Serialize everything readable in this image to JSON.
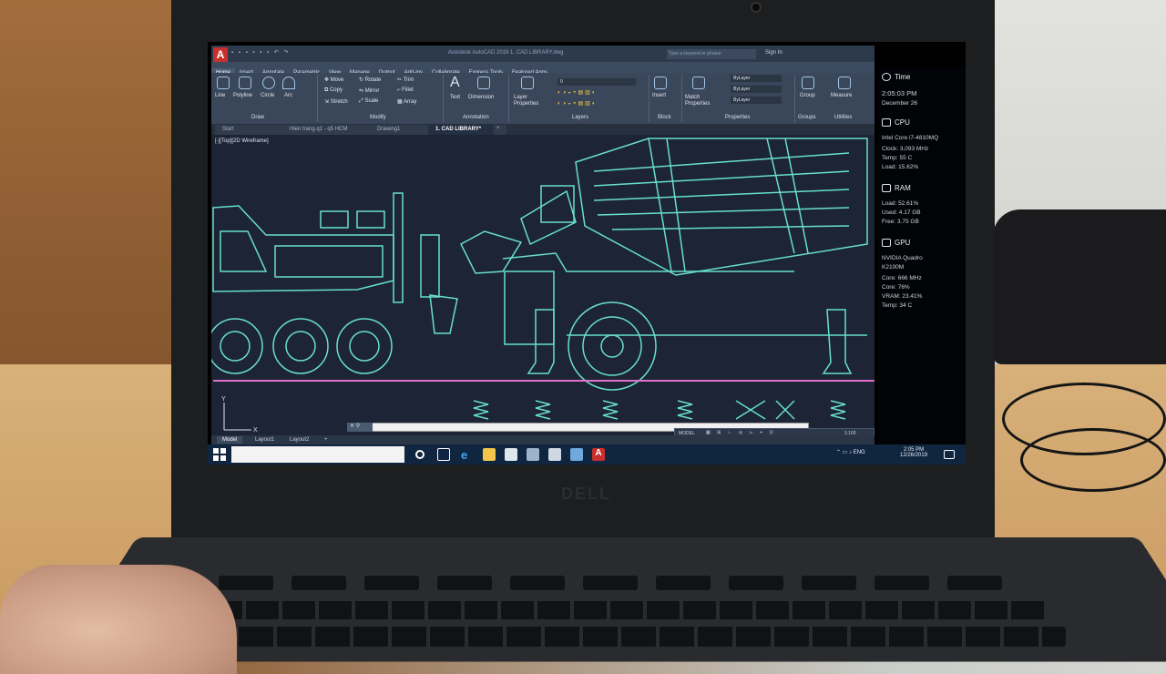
{
  "window": {
    "app_logo": "A",
    "title": "Autodesk AutoCAD 2019    1. CAD LIBRARY.dwg",
    "search_placeholder": "Type a keyword or phrase",
    "signin": "Sign In"
  },
  "menu": [
    "Home",
    "Insert",
    "Annotate",
    "Parametric",
    "View",
    "Manage",
    "Output",
    "Add-ins",
    "Collaborate",
    "Express Tools",
    "Featured Apps"
  ],
  "ribbon": {
    "draw": [
      "Line",
      "Polyline",
      "Circle",
      "Arc"
    ],
    "modify": [
      "Move",
      "Rotate",
      "Trim",
      "Copy",
      "Mirror",
      "Fillet",
      "Stretch",
      "Scale",
      "Array"
    ],
    "annotation": [
      "Text",
      "Dimension"
    ],
    "layers": [
      "Layer Properties"
    ],
    "layer_value": "0",
    "block": [
      "Insert"
    ],
    "properties": [
      "Match Properties"
    ],
    "bylayer": [
      "ByLayer",
      "ByLayer",
      "ByLayer"
    ],
    "groups": [
      "Group"
    ],
    "utilities": [
      "Measure"
    ],
    "panels": [
      "Draw",
      "Modify",
      "Annotation",
      "Layers",
      "Block",
      "Properties",
      "Groups",
      "Utilities"
    ]
  },
  "file_tabs": [
    "Start",
    "Hien trang q1 - q5 HCM",
    "Drawing1",
    "1. CAD LIBRARY*"
  ],
  "viewport_label": "[-][Top][2D Wireframe]",
  "layout_tabs": [
    "Model",
    "Layout1",
    "Layout2"
  ],
  "status": {
    "model": "MODEL",
    "scale": "1:100"
  },
  "taskbar": {
    "search_placeholder": "",
    "tray_lang": "ENG",
    "time": "2:05 PM",
    "date": "12/26/2019"
  },
  "sidebar": {
    "time_head": "Time",
    "time": "2:05:03 PM",
    "date": "December 26",
    "cpu_head": "CPU",
    "cpu_name": "Intel Core i7-4810MQ",
    "cpu_clock": "Clock: 3,093 MHz",
    "cpu_temp": "Temp: 55 C",
    "cpu_load": "Load: 15.62%",
    "ram_head": "RAM",
    "ram_load": "Load: 52.61%",
    "ram_used": "Used: 4.17 GB",
    "ram_free": "Free: 3.75 GB",
    "gpu_head": "GPU",
    "gpu_name": "NVIDIA Quadro",
    "gpu_model": "K2100M",
    "gpu_core": "Core: 666 MHz",
    "gpu_load": "Core: 76%",
    "gpu_vram": "VRAM: 23.41%",
    "gpu_temp": "Temp: 34 C"
  },
  "colors": {
    "drawing": "#68e0c8",
    "ground": "#e070c8",
    "canvas": "#1c2436",
    "accent": "#c8302d"
  },
  "laptop_brand": "DELL"
}
